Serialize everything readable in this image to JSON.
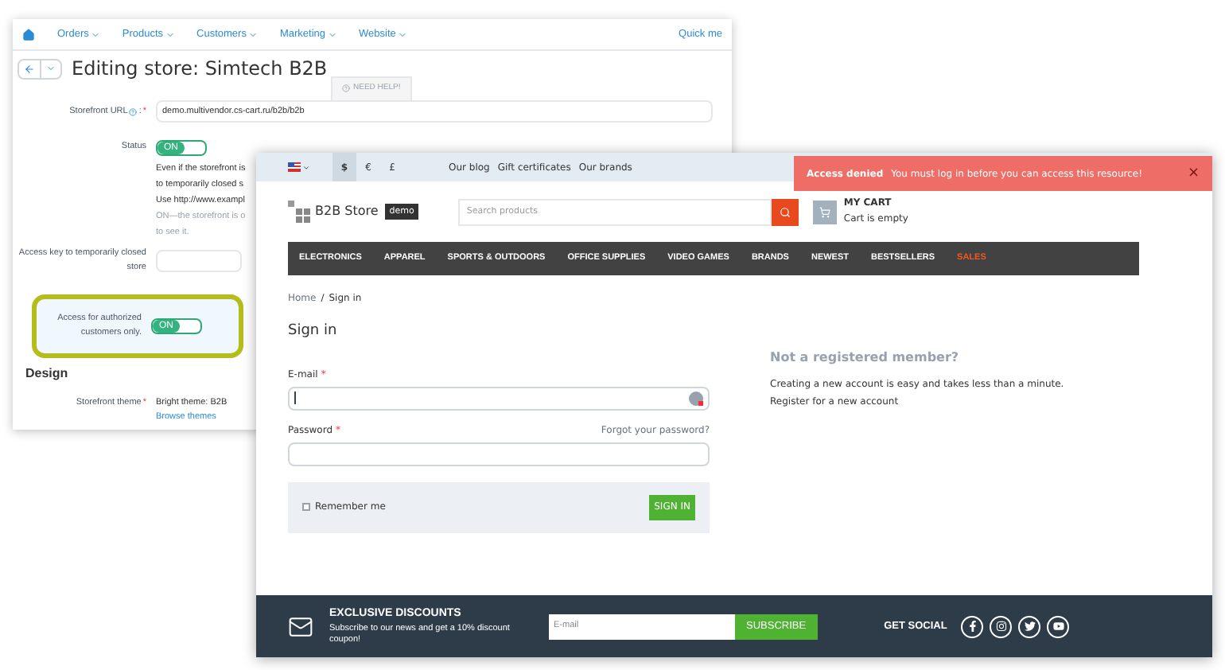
{
  "admin": {
    "menu": [
      {
        "label": "Orders"
      },
      {
        "label": "Products"
      },
      {
        "label": "Customers"
      },
      {
        "label": "Marketing"
      },
      {
        "label": "Website"
      }
    ],
    "quick_menu": "Quick me",
    "title": "Editing store: Simtech B2B",
    "help_tab": "NEED HELP!",
    "url_field": {
      "label": "Storefront URL",
      "colon": ":",
      "required": "*",
      "value": "demo.multivendor.cs-cart.ru/b2b/b2b"
    },
    "status": {
      "label": "Status",
      "toggle": "ON",
      "on": true,
      "notes": [
        "Even if the storefront is",
        "to temporarily closed s",
        "Use http://www.exampl"
      ],
      "muted_notes": [
        "ON—the storefront is o",
        "to see it."
      ]
    },
    "access_key": {
      "label": "Access key to temporarily closed store"
    },
    "authorized_only": {
      "label": "Access for authorized customers only.",
      "toggle": "ON",
      "on": true,
      "highlighted": true
    },
    "section": "Design",
    "theme": {
      "label": "Storefront theme",
      "required": "*",
      "value": "Bright theme: B2B",
      "link": "Browse themes"
    }
  },
  "store": {
    "currencies": [
      {
        "label": "$",
        "selected": true
      },
      {
        "label": "€",
        "selected": false
      },
      {
        "label": "£",
        "selected": false
      }
    ],
    "top_links": [
      "Our blog",
      "Gift certificates",
      "Our brands"
    ],
    "alert": {
      "title": "Access denied",
      "message": "You must log in before you can access this resource!",
      "close": "×"
    },
    "logo": {
      "name": "B2B Store",
      "badge": "demo"
    },
    "search": {
      "placeholder": "Search products"
    },
    "cart": {
      "title": "MY CART",
      "status": "Cart is empty"
    },
    "categories": [
      {
        "label": "ELECTRONICS",
        "kind": "normal"
      },
      {
        "label": "APPAREL",
        "kind": "normal"
      },
      {
        "label": "SPORTS & OUTDOORS",
        "kind": "normal"
      },
      {
        "label": "OFFICE SUPPLIES",
        "kind": "normal"
      },
      {
        "label": "VIDEO GAMES",
        "kind": "normal"
      },
      {
        "label": "BRANDS",
        "kind": "normal"
      },
      {
        "label": "NEWEST",
        "kind": "normal"
      },
      {
        "label": "BESTSELLERS",
        "kind": "normal"
      },
      {
        "label": "SALES",
        "kind": "sale"
      }
    ],
    "breadcrumbs": [
      "Home",
      "/",
      "Sign in"
    ],
    "heading": "Sign in",
    "email": {
      "label": "E-mail",
      "required": "*"
    },
    "password": {
      "label": "Password",
      "required": "*",
      "forgot": "Forgot your password?"
    },
    "remember": {
      "label": "Remember me",
      "checked": false
    },
    "sign_in_button": "SIGN IN",
    "register": {
      "title": "Not a registered member?",
      "text": "Creating a new account is easy and takes less than a minute.",
      "link": "Register for a new account"
    },
    "footer": {
      "title": "EXCLUSIVE DISCOUNTS",
      "text": "Subscribe to our news and get a 10% discount coupon!",
      "email_placeholder": "E-mail",
      "subscribe": "SUBSCRIBE",
      "social_title": "GET SOCIAL"
    }
  }
}
